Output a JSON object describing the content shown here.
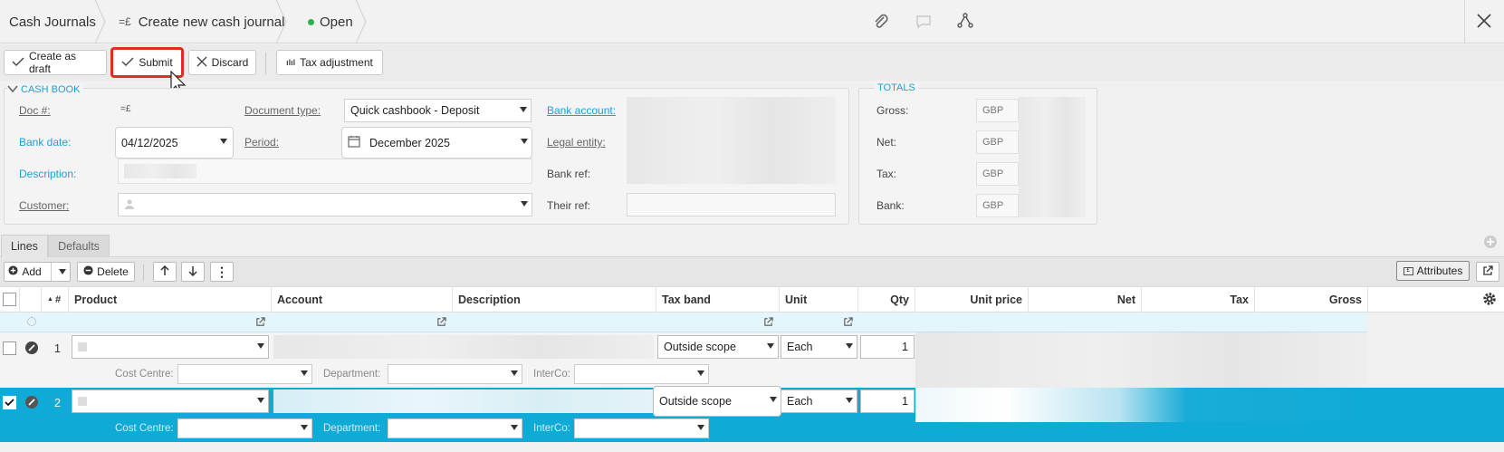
{
  "breadcrumb": {
    "root": "Cash Journals",
    "create_label": "Create new cash journal",
    "status": "Open"
  },
  "toolbar": {
    "create_draft": "Create as draft",
    "submit": "Submit",
    "discard": "Discard",
    "tax_adjustment": "Tax adjustment"
  },
  "cashbook": {
    "section_title": "CASH BOOK",
    "doc_label": "Doc #:",
    "doc_type_label": "Document type:",
    "doc_type_value": "Quick cashbook - Deposit",
    "bank_account_label": "Bank account:",
    "bank_date_label": "Bank date:",
    "bank_date_value": "04/12/2025",
    "period_label": "Period:",
    "period_value": "December 2025",
    "legal_entity_label": "Legal entity:",
    "description_label": "Description:",
    "bank_ref_label": "Bank ref:",
    "customer_label": "Customer:",
    "their_ref_label": "Their ref:"
  },
  "totals": {
    "section_title": "TOTALS",
    "rows": [
      {
        "label": "Gross:",
        "currency": "GBP"
      },
      {
        "label": "Net:",
        "currency": "GBP"
      },
      {
        "label": "Tax:",
        "currency": "GBP"
      },
      {
        "label": "Bank:",
        "currency": "GBP"
      }
    ]
  },
  "tabs": {
    "lines": "Lines",
    "defaults": "Defaults"
  },
  "grid_toolbar": {
    "add": "Add",
    "delete": "Delete",
    "attributes": "Attributes"
  },
  "columns": {
    "num": "#",
    "product": "Product",
    "account": "Account",
    "description": "Description",
    "tax_band": "Tax band",
    "unit": "Unit",
    "qty": "Qty",
    "unit_price": "Unit price",
    "net": "Net",
    "tax": "Tax",
    "gross": "Gross"
  },
  "rows": [
    {
      "num": "1",
      "tax_band": "Outside scope",
      "unit": "Each",
      "qty": "1",
      "checked": false
    },
    {
      "num": "2",
      "tax_band": "Outside scope",
      "unit": "Each",
      "qty": "1",
      "checked": true
    }
  ],
  "subfields": {
    "cost_centre": "Cost Centre:",
    "department": "Department:",
    "interco": "InterCo:"
  },
  "colors": {
    "accent": "#1aa1d4",
    "highlight": "#e02d22",
    "status_dot": "#2bb24c"
  }
}
